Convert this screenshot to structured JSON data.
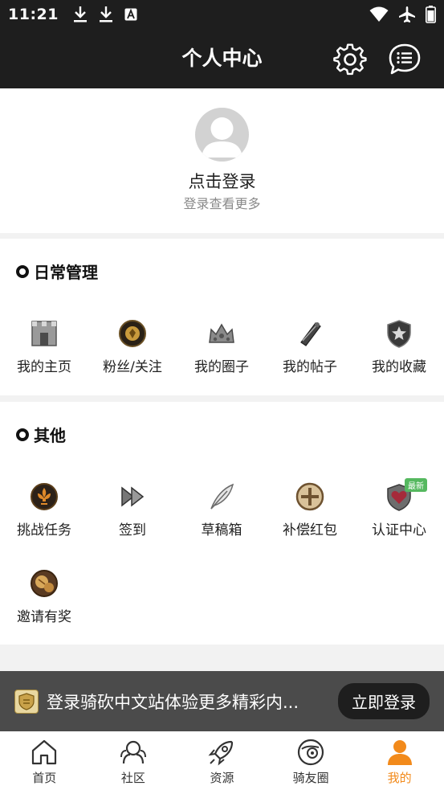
{
  "status_bar": {
    "time": "11:21",
    "left_icons": [
      "download-icon",
      "download-icon",
      "a-icon"
    ],
    "right_icons": [
      "wifi-icon",
      "airplane-icon",
      "battery-icon"
    ]
  },
  "header": {
    "title": "个人中心"
  },
  "profile": {
    "login_text": "点击登录",
    "sub_text": "登录查看更多"
  },
  "daily": {
    "title": "日常管理",
    "items": [
      {
        "label": "我的主页",
        "icon": "castle-icon"
      },
      {
        "label": "粉丝/关注",
        "icon": "medal-icon"
      },
      {
        "label": "我的圈子",
        "icon": "crown-icon"
      },
      {
        "label": "我的帖子",
        "icon": "scroll-icon"
      },
      {
        "label": "我的收藏",
        "icon": "star-shield-icon"
      }
    ]
  },
  "other": {
    "title": "其他",
    "items": [
      {
        "label": "挑战任务",
        "icon": "fleur-icon"
      },
      {
        "label": "签到",
        "icon": "fast-forward-icon"
      },
      {
        "label": "草稿箱",
        "icon": "feather-icon"
      },
      {
        "label": "补偿红包",
        "icon": "plus-circle-icon"
      },
      {
        "label": "认证中心",
        "icon": "heart-shield-icon",
        "badge": "最新"
      },
      {
        "label": "邀请有奖",
        "icon": "bell-icon"
      }
    ]
  },
  "banner": {
    "text": "登录骑砍中文站体验更多精彩内...",
    "button": "立即登录"
  },
  "tabs": [
    {
      "label": "首页",
      "icon": "home-icon"
    },
    {
      "label": "社区",
      "icon": "community-icon"
    },
    {
      "label": "资源",
      "icon": "rocket-icon"
    },
    {
      "label": "骑友圈",
      "icon": "planet-icon"
    },
    {
      "label": "我的",
      "icon": "person-icon",
      "active": true
    }
  ],
  "colors": {
    "header_bg": "#1e1e1e",
    "accent": "#f28a1b",
    "badge": "#55b85f"
  }
}
